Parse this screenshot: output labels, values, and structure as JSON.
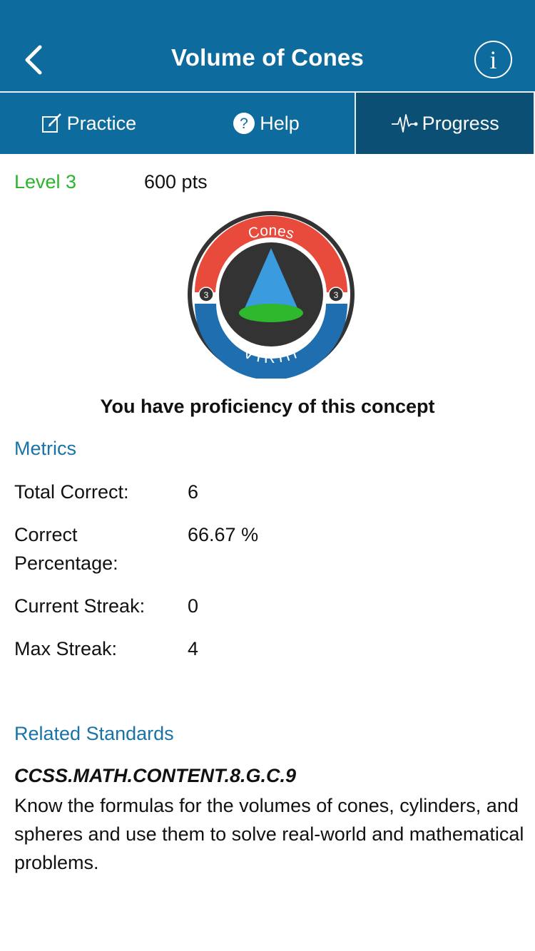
{
  "header": {
    "title": "Volume of Cones",
    "info_glyph": "i"
  },
  "tabs": [
    {
      "label": "Practice",
      "icon": "edit-icon",
      "active": false
    },
    {
      "label": "Help",
      "icon": "question-icon",
      "active": false
    },
    {
      "label": "Progress",
      "icon": "pulse-icon",
      "active": true
    }
  ],
  "level": {
    "label": "Level 3",
    "points": "600 pts"
  },
  "badge": {
    "top_text": "Cones",
    "bottom_text": "VIRIH",
    "level_number": "3",
    "colors": {
      "ring_top": "#e84a3c",
      "ring_bottom": "#1f6fb0",
      "inner": "#333333",
      "cone": "#3a9bde",
      "cone_base": "#2db82d"
    }
  },
  "proficiency_text": "You have proficiency of this concept",
  "metrics": {
    "title": "Metrics",
    "items": [
      {
        "label": "Total Correct:",
        "value": "6"
      },
      {
        "label": "Correct Percentage:",
        "value": "66.67 %"
      },
      {
        "label": "Current Streak:",
        "value": "0"
      },
      {
        "label": "Max Streak:",
        "value": "4"
      }
    ]
  },
  "standards": {
    "title": "Related Standards",
    "code": "CCSS.MATH.CONTENT.8.G.C.9",
    "description": "Know the formulas for the volumes of cones, cylinders, and spheres and use them to solve real-world and mathematical problems."
  },
  "colors": {
    "brand": "#0e6b9e",
    "active_tab": "#0c4f74",
    "level_green": "#2db32d",
    "section_blue": "#1a73a8"
  }
}
